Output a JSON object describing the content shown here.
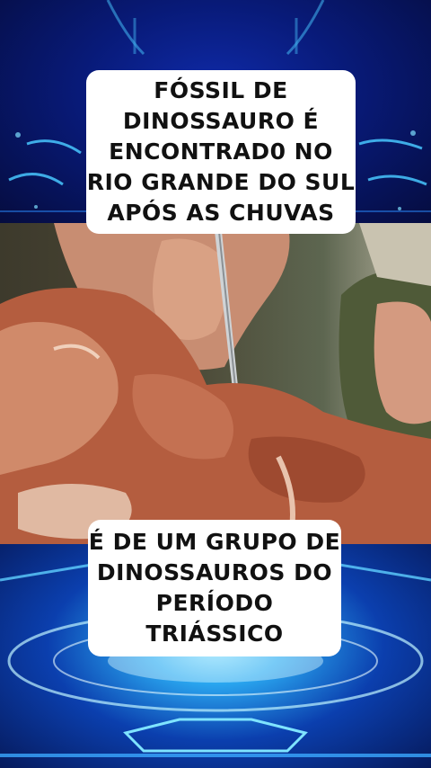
{
  "captions": {
    "top": [
      "FÓSSIL DE",
      "DINOSSAURO É",
      "ENCONTRAD0 NO",
      "RIO GRANDE DO SUL",
      "APÓS AS CHUVAS"
    ],
    "bottom": [
      "É DE UM GRUPO DE",
      "DINOSSAUROS DO",
      "PERÍODO TRIÁSSICO"
    ]
  },
  "colors": {
    "caption_bg": "#ffffff",
    "caption_text": "#111111",
    "accent_blue": "#1f6cff"
  }
}
